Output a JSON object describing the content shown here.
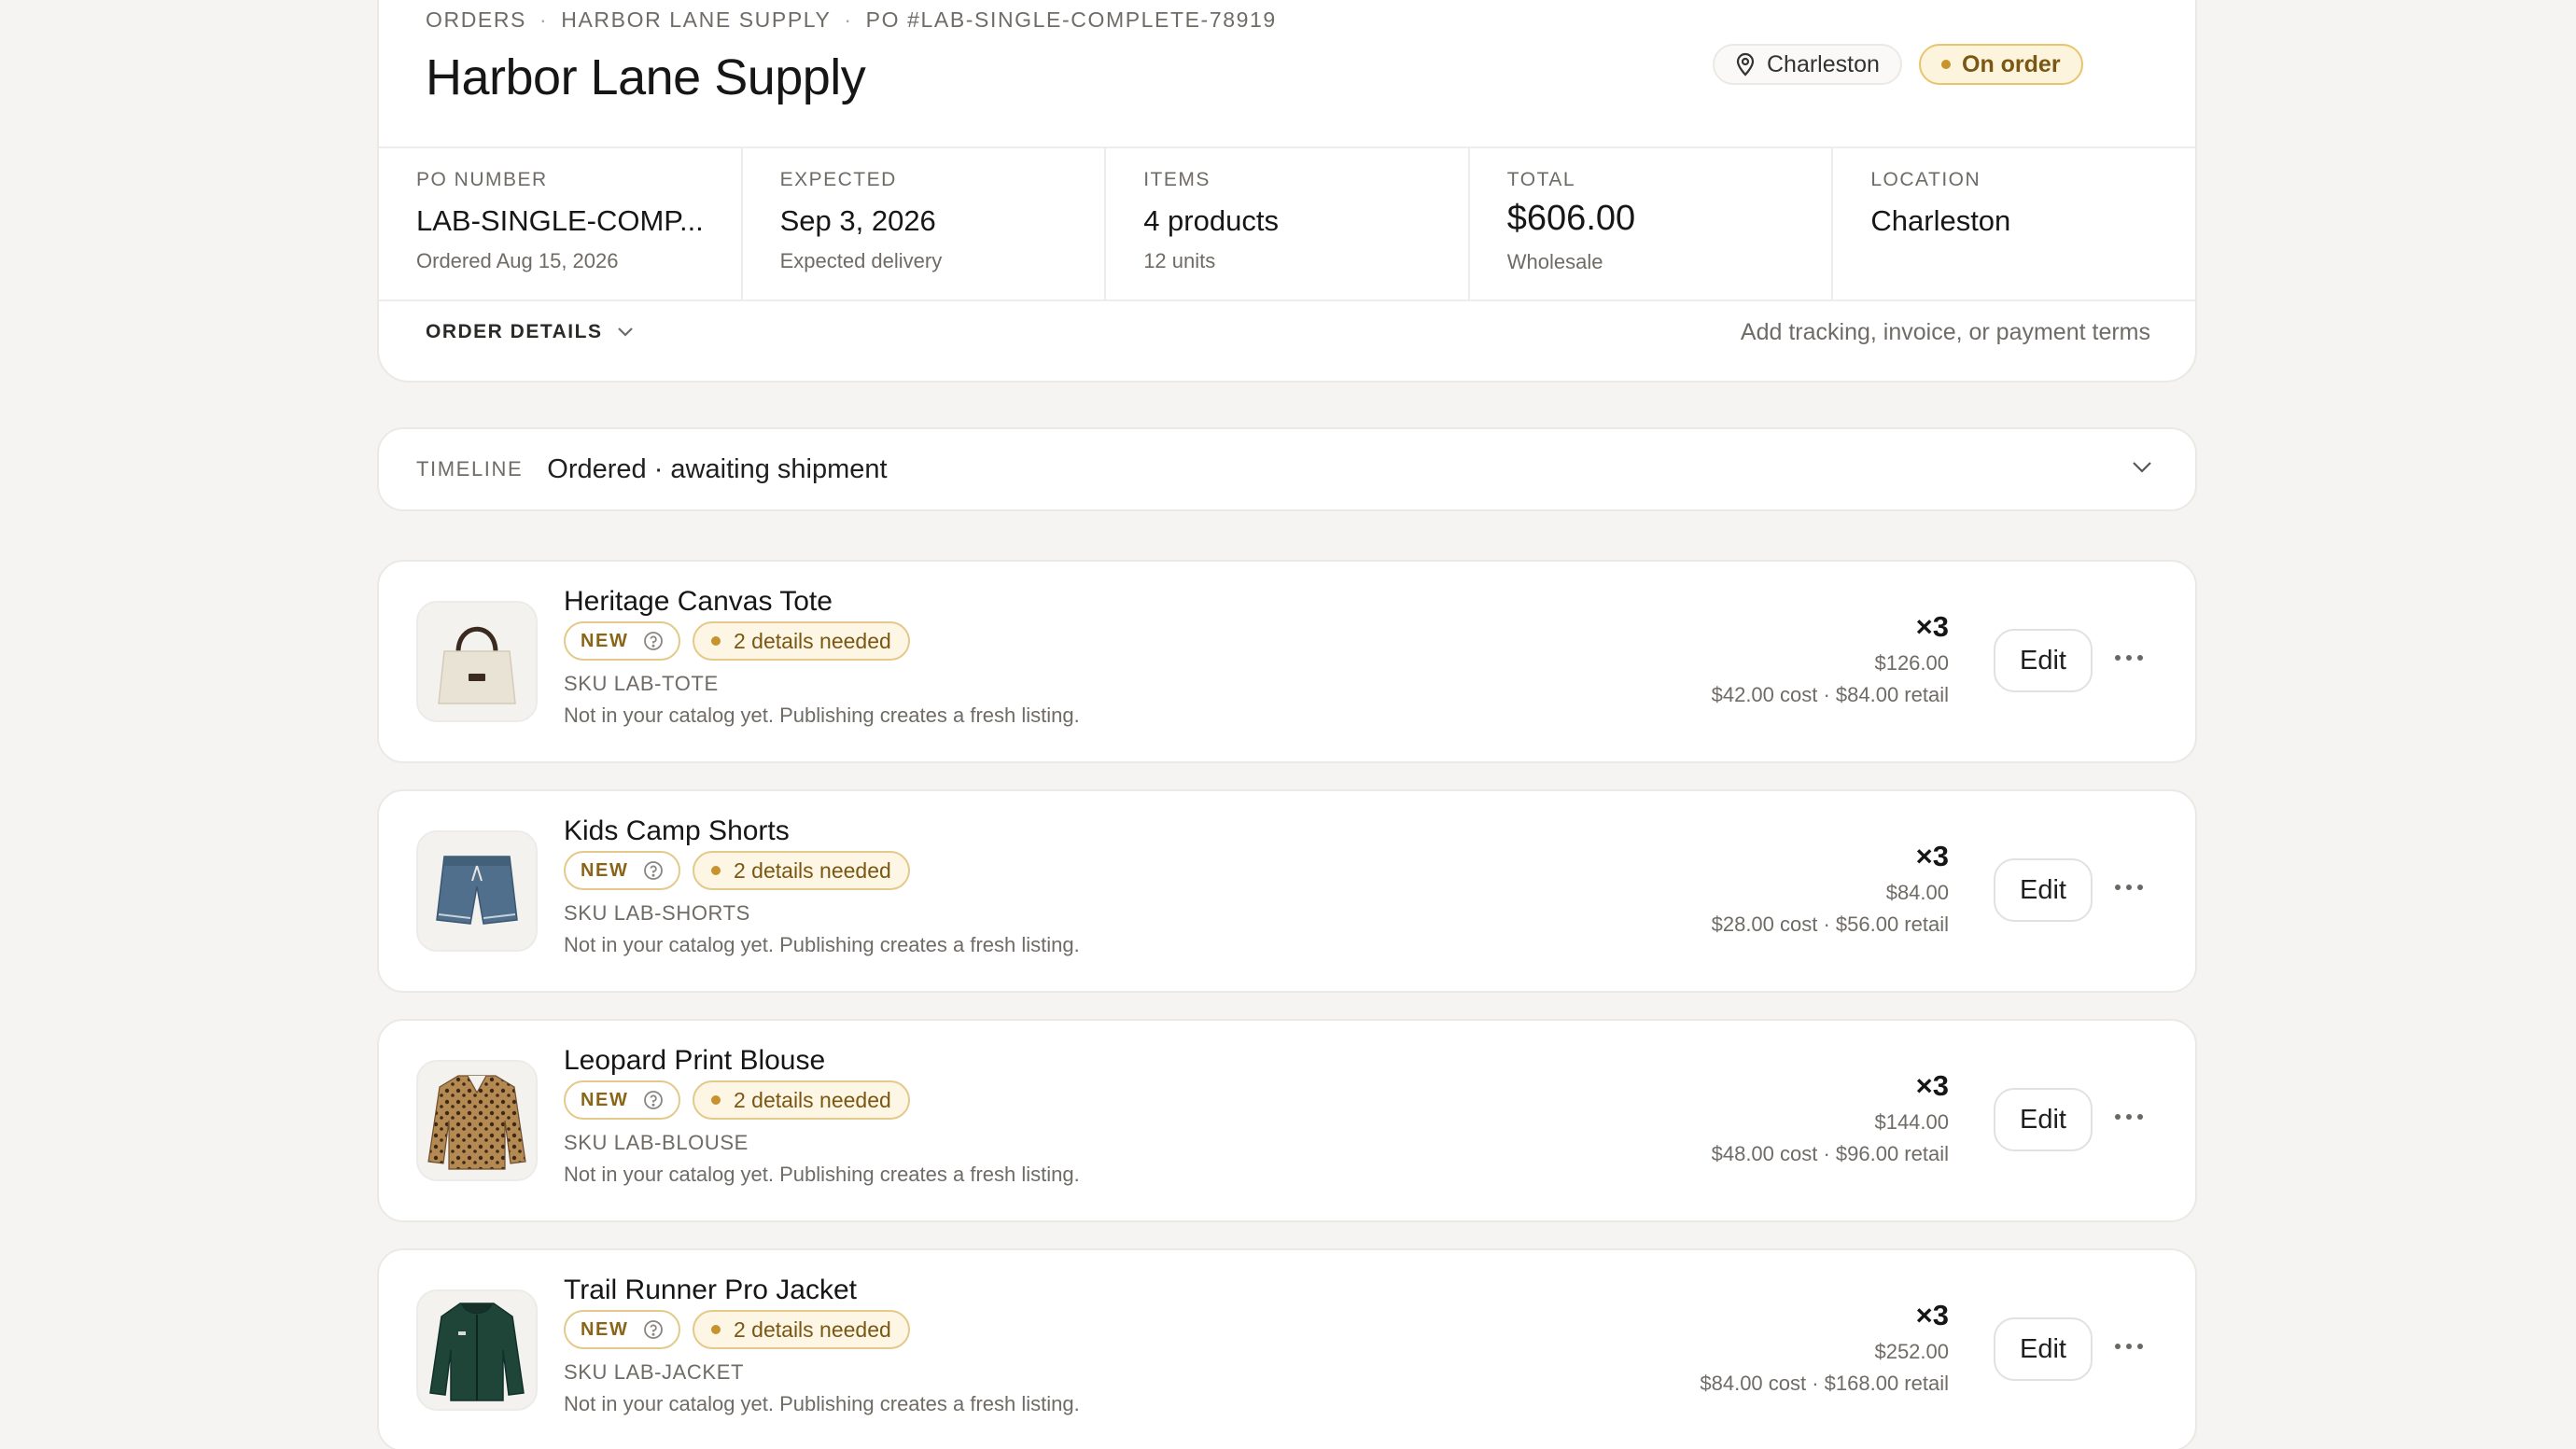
{
  "breadcrumb": {
    "orders": "ORDERS",
    "supplier": "HARBOR LANE SUPPLY",
    "po": "PO #LAB-SINGLE-COMPLETE-78919",
    "separator": "·"
  },
  "page": {
    "title": "Harbor Lane Supply"
  },
  "header_chips": {
    "location": "Charleston",
    "status": "On order",
    "status_color": "#c6932e"
  },
  "stats": [
    {
      "label": "PO NUMBER",
      "value": "LAB-SINGLE-COMP...",
      "sub": "Ordered Aug 15, 2026"
    },
    {
      "label": "EXPECTED",
      "value": "Sep 3, 2026",
      "sub": "Expected delivery"
    },
    {
      "label": "ITEMS",
      "value": "4 products",
      "sub": "12 units"
    },
    {
      "label": "TOTAL",
      "value": "$606.00",
      "sub": "Wholesale"
    },
    {
      "label": "LOCATION",
      "value": "Charleston",
      "sub": ""
    }
  ],
  "order_details": {
    "label": "ORDER DETAILS",
    "hint": "Add tracking, invoice, or payment terms"
  },
  "timeline": {
    "label": "TIMELINE",
    "text": "Ordered · awaiting shipment"
  },
  "products": [
    {
      "name": "Heritage Canvas Tote",
      "badge_new": "NEW",
      "details_needed": "2 details needed",
      "sku": "SKU LAB-TOTE",
      "note": "Not in your catalog yet. Publishing creates a fresh listing.",
      "qty": "×3",
      "total": "$126.00",
      "cost_retail": "$42.00 cost · $84.00 retail",
      "edit_label": "Edit",
      "icon": "tote-bag-icon"
    },
    {
      "name": "Kids Camp Shorts",
      "badge_new": "NEW",
      "details_needed": "2 details needed",
      "sku": "SKU LAB-SHORTS",
      "note": "Not in your catalog yet. Publishing creates a fresh listing.",
      "qty": "×3",
      "total": "$84.00",
      "cost_retail": "$28.00 cost · $56.00 retail",
      "edit_label": "Edit",
      "icon": "shorts-icon"
    },
    {
      "name": "Leopard Print Blouse",
      "badge_new": "NEW",
      "details_needed": "2 details needed",
      "sku": "SKU LAB-BLOUSE",
      "note": "Not in your catalog yet. Publishing creates a fresh listing.",
      "qty": "×3",
      "total": "$144.00",
      "cost_retail": "$48.00 cost · $96.00 retail",
      "edit_label": "Edit",
      "icon": "blouse-icon"
    },
    {
      "name": "Trail Runner Pro Jacket",
      "badge_new": "NEW",
      "details_needed": "2 details needed",
      "sku": "SKU LAB-JACKET",
      "note": "Not in your catalog yet. Publishing creates a fresh listing.",
      "qty": "×3",
      "total": "$252.00",
      "cost_retail": "$84.00 cost · $168.00 retail",
      "edit_label": "Edit",
      "icon": "jacket-icon"
    }
  ]
}
